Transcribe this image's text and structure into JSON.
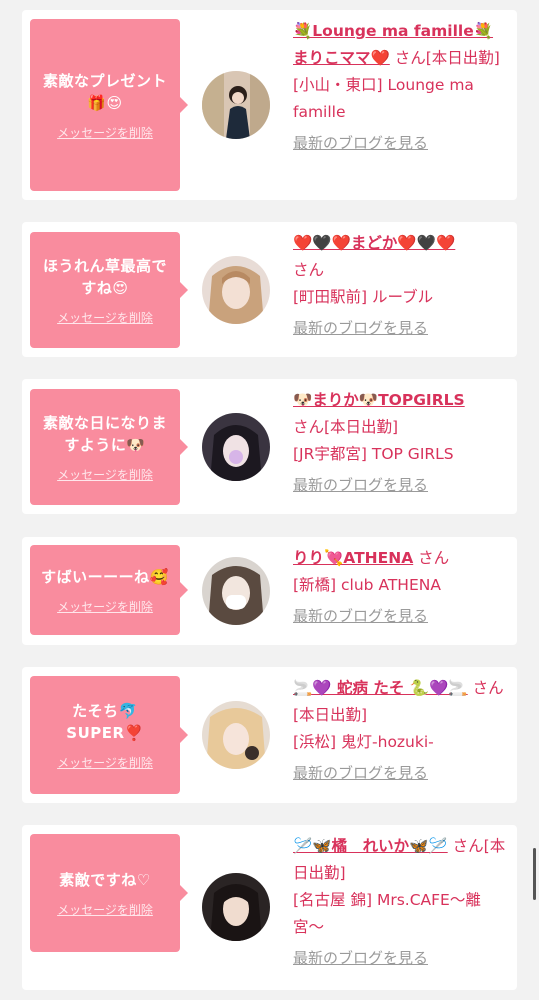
{
  "cards": [
    {
      "message": "素敵なプレゼント🎁😍",
      "delete_label": "メッセージを削除",
      "name": "💐Lounge ma famille💐まりこママ❤️",
      "suffix": "さん[本日出勤]",
      "shop": "[小山・東口] Lounge ma famille",
      "blog": "最新のブログを見る",
      "avatar": "avatar-photo-1"
    },
    {
      "message": "ほうれん草最高ですね😍",
      "delete_label": "メッセージを削除",
      "name": "❤️🖤❤️まどか❤️🖤❤️",
      "suffix": "さん",
      "shop": "[町田駅前] ルーブル",
      "blog": "最新のブログを見る",
      "avatar": "avatar-photo-2"
    },
    {
      "message": "素敵な日になりますように🐶",
      "delete_label": "メッセージを削除",
      "name": "🐶まりか🐶TOPGIRLS",
      "suffix": "さん[本日出勤]",
      "shop": "[JR宇都宮] TOP GIRLS",
      "blog": "最新のブログを見る",
      "avatar": "avatar-photo-3"
    },
    {
      "message": "すばいーーーね🥰",
      "delete_label": "メッセージを削除",
      "name": "りり💘ATHENA",
      "suffix": "さん",
      "shop": "[新橋] club ATHENA",
      "blog": "最新のブログを見る",
      "avatar": "avatar-photo-4"
    },
    {
      "message": "たそち🐬SUPER❣️",
      "delete_label": "メッセージを削除",
      "name": "🚬💜 蛇病 たそ 🐍💜🚬",
      "suffix": "さん[本日出勤]",
      "shop": "[浜松] 鬼灯-hozuki-",
      "blog": "最新のブログを見る",
      "avatar": "avatar-photo-5"
    },
    {
      "message": "素敵ですね♡",
      "delete_label": "メッセージを削除",
      "name": "🪡🦋橘　れいか🦋🪡",
      "suffix": "さん[本日出勤]",
      "shop": "[名古屋 錦] Mrs.CAFE〜離宮〜",
      "blog": "最新のブログを見る",
      "avatar": "avatar-photo-6"
    }
  ],
  "colors": {
    "page_bg": "#f2f2f2",
    "bubble": "#f98c9e",
    "accent_text": "#d8325b",
    "link_gray": "#9a9a9a"
  }
}
